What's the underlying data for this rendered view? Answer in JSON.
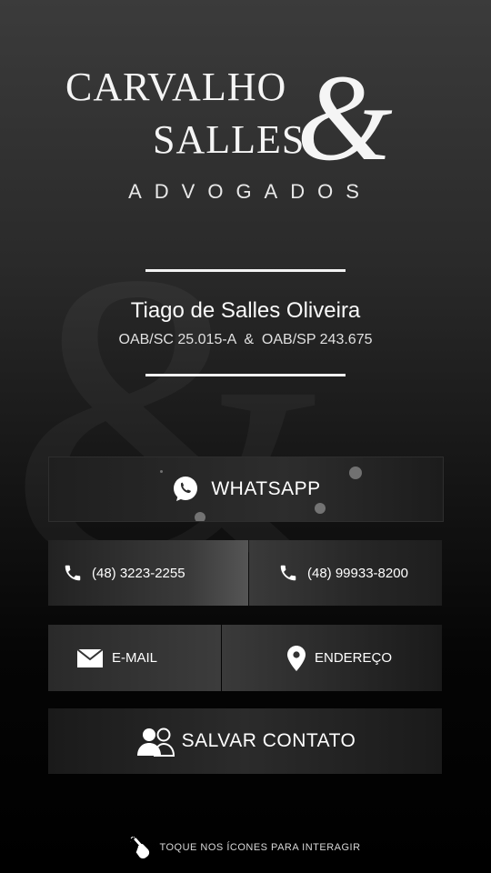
{
  "logo": {
    "line1": "CARVALHO",
    "line2": "SALLES",
    "ampersand": "&",
    "subtitle": "ADVOGADOS"
  },
  "person": {
    "name": "Tiago de Salles Oliveira",
    "oab": "OAB/SC 25.015-A  &  OAB/SP 243.675"
  },
  "buttons": {
    "whatsapp": "WHATSAPP",
    "phone1": "(48) 3223-2255",
    "phone2": "(48) 99933-8200",
    "email": "E-MAIL",
    "address": "ENDEREÇO",
    "save_contact": "SALVAR CONTATO"
  },
  "hint": "TOQUE NOS ÍCONES PARA INTERAGIR",
  "icons": {
    "whatsapp": "whatsapp-icon",
    "phone": "phone-icon",
    "email": "envelope-icon",
    "address": "map-pin-icon",
    "contact": "contact-card-icon",
    "hint": "tap-hand-icon"
  },
  "colors": {
    "background_top": "#3b3b3b",
    "background_bottom": "#000000",
    "text": "#ffffff"
  }
}
